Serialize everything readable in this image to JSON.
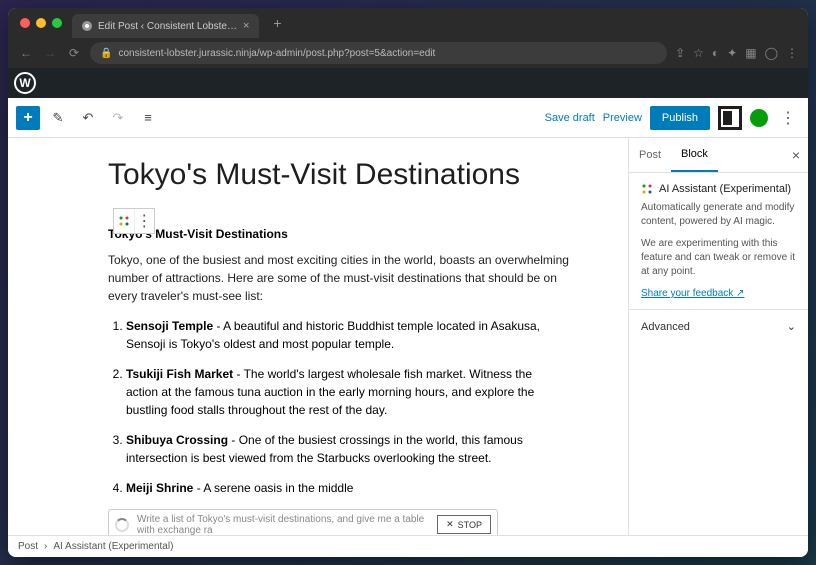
{
  "browser": {
    "tab_title": "Edit Post ‹ Consistent Lobste…",
    "url": "consistent-lobster.jurassic.ninja/wp-admin/post.php?post=5&action=edit"
  },
  "toolbar": {
    "save_draft": "Save draft",
    "preview": "Preview",
    "publish": "Publish"
  },
  "post": {
    "title": "Tokyo's Must-Visit Destinations",
    "subheading": "Tokyo's Must-Visit Destinations",
    "intro": "Tokyo, one of the busiest and most exciting cities in the world, boasts an overwhelming number of attractions. Here are some of the must-visit destinations that should be on every traveler's must-see list:",
    "items": [
      {
        "name": "Sensoji Temple",
        "text": " - A beautiful and historic Buddhist temple located in Asakusa, Sensoji is Tokyo's oldest and most popular temple."
      },
      {
        "name": "Tsukiji Fish Market",
        "text": " - The world's largest wholesale fish market. Witness the action at the famous tuna auction in the early morning hours, and explore the bustling food stalls throughout the rest of the day."
      },
      {
        "name": "Shibuya Crossing",
        "text": " - One of the busiest crossings in the world, this famous intersection is best viewed from the Starbucks overlooking the street."
      },
      {
        "name": "Meiji Shrine",
        "text": " - A serene oasis in the middle"
      }
    ]
  },
  "ai": {
    "prompt": "Write a list of Tokyo's must-visit destinations, and give me a table with exchange ra",
    "stop": "STOP"
  },
  "sidebar": {
    "tab_post": "Post",
    "tab_block": "Block",
    "panel_title": "AI Assistant (Experimental)",
    "panel_desc1": "Automatically generate and modify content, powered by AI magic.",
    "panel_desc2": "We are experimenting with this feature and can tweak or remove it at any point.",
    "feedback": "Share your feedback",
    "advanced": "Advanced"
  },
  "footer": {
    "crumb1": "Post",
    "crumb2": "AI Assistant (Experimental)"
  }
}
